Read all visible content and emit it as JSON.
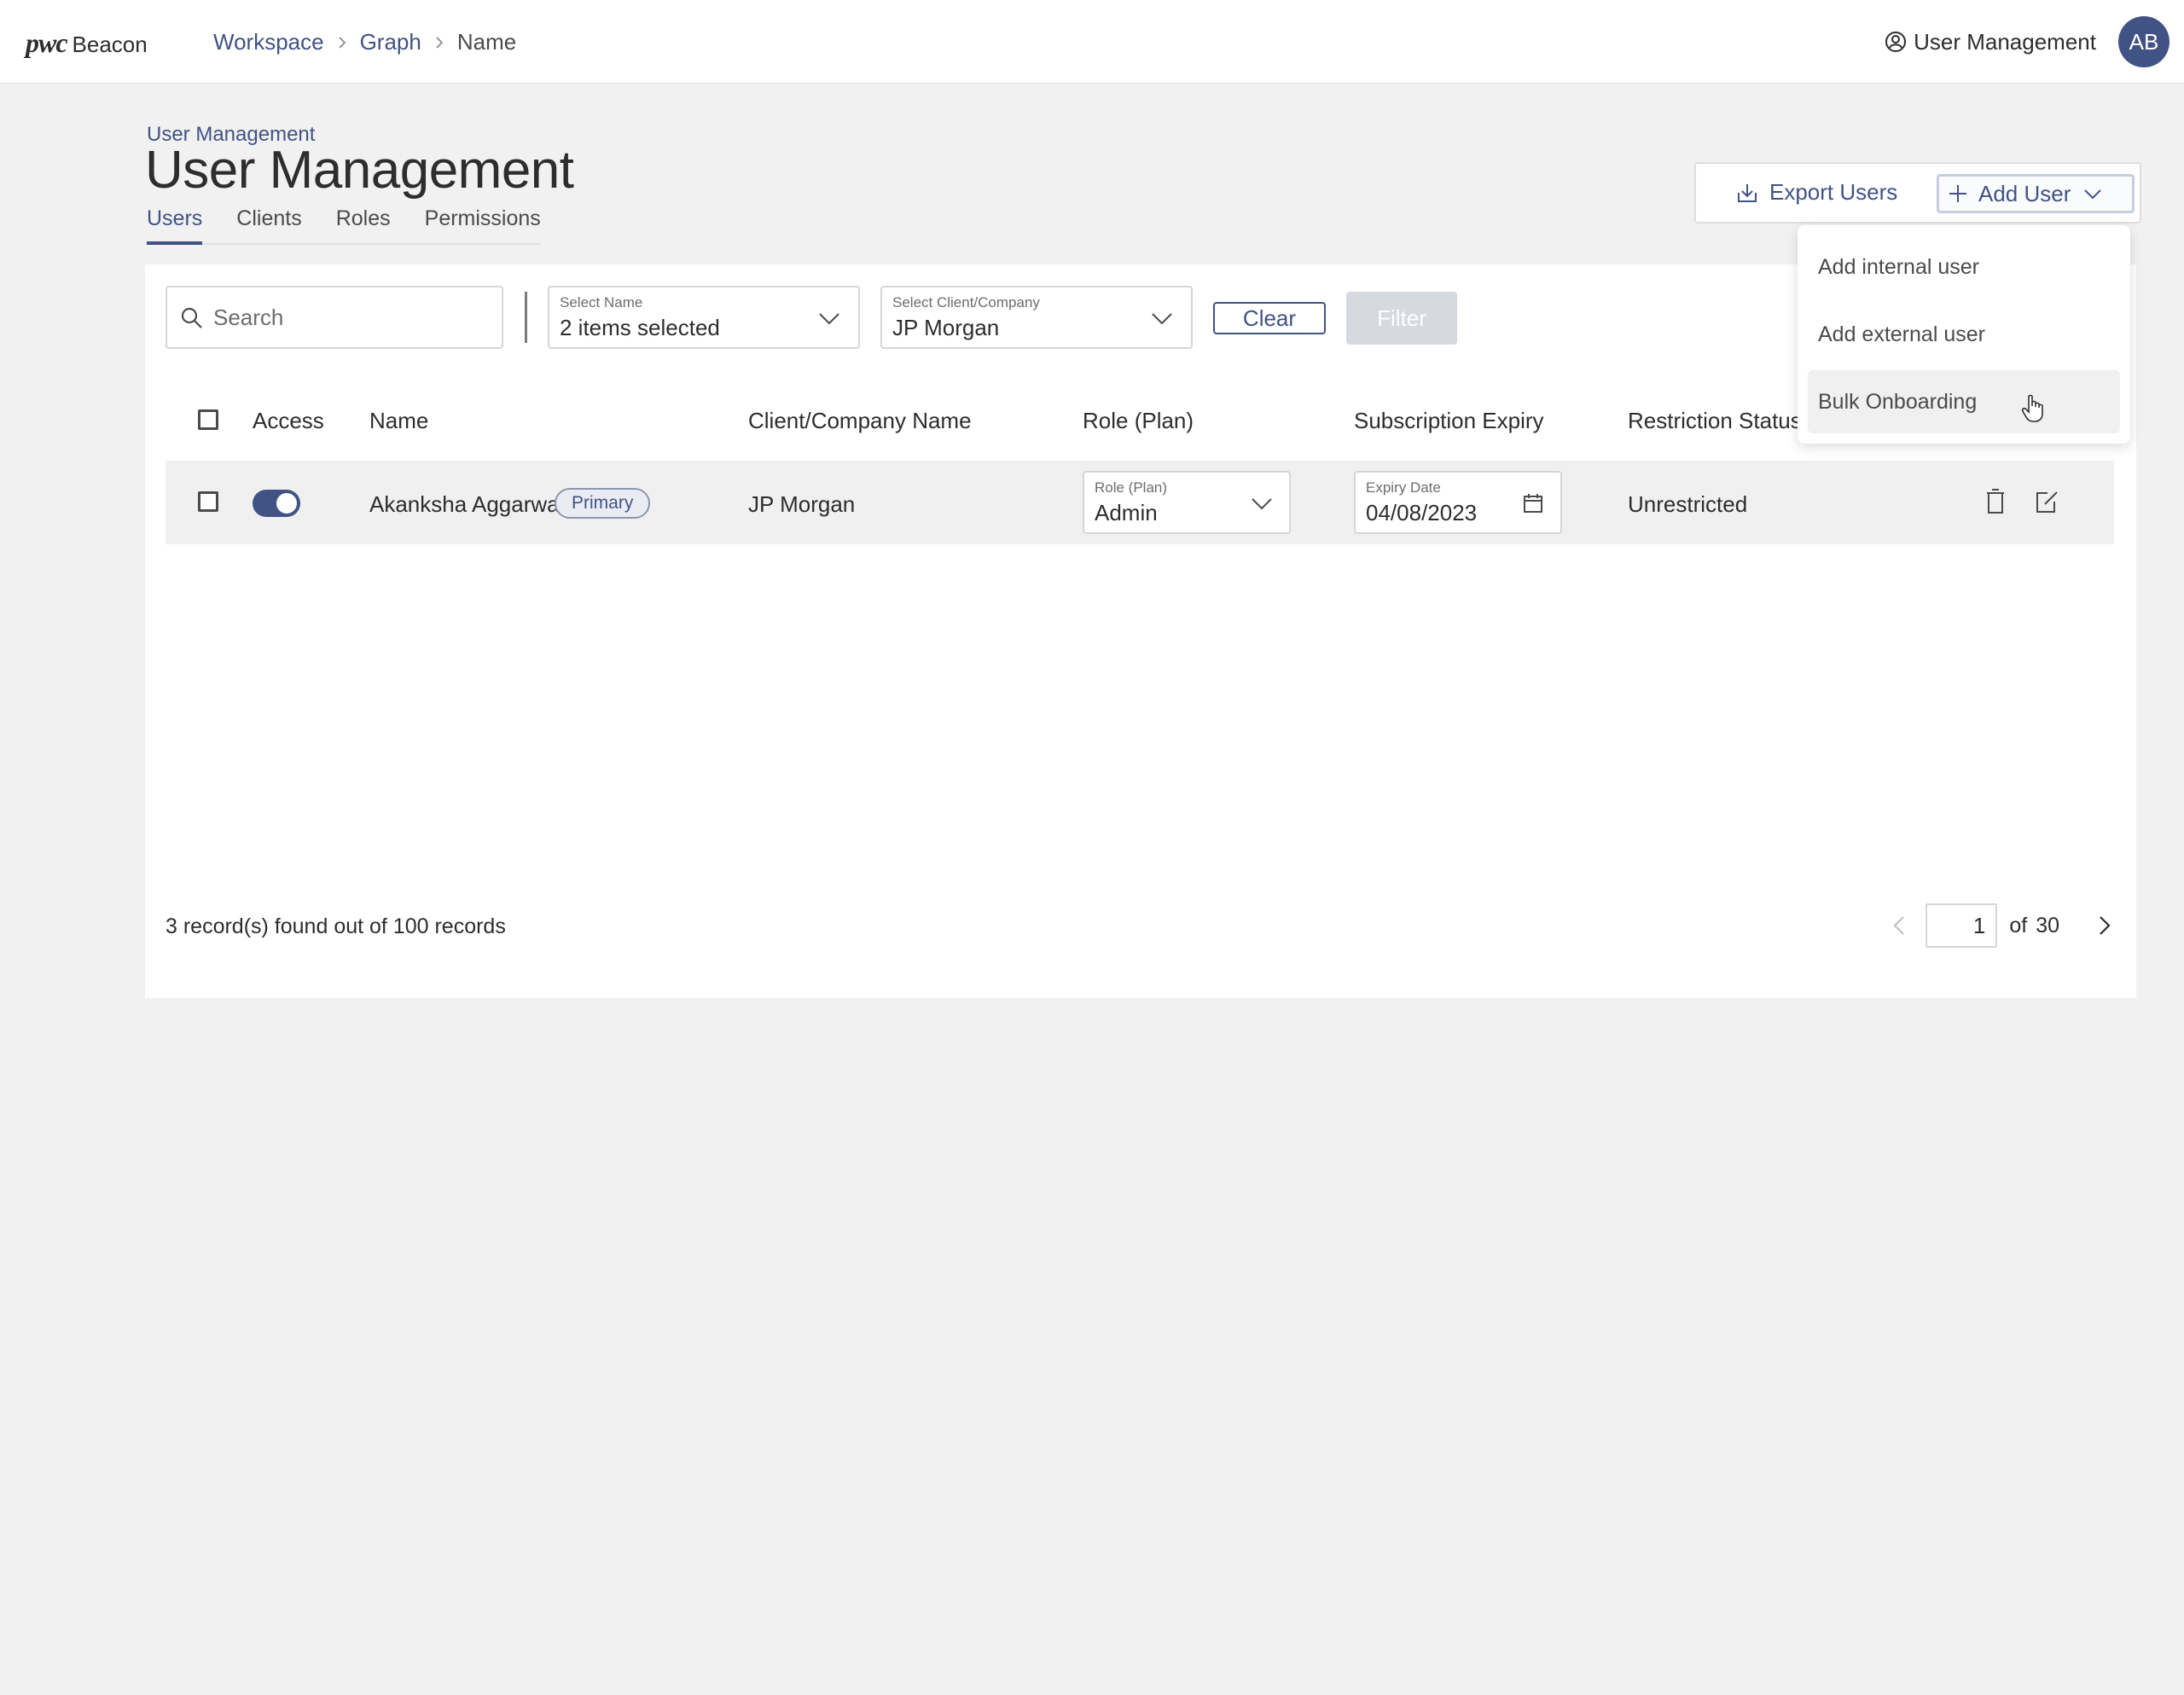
{
  "header": {
    "logo_mark": "pwc",
    "logo_text": "Beacon",
    "breadcrumb": [
      {
        "label": "Workspace"
      },
      {
        "label": "Graph"
      },
      {
        "label": "Name"
      }
    ],
    "user_management_label": "User Management",
    "user_management_icon": "user-circle-icon",
    "avatar_initials": "AB"
  },
  "page": {
    "breadcrumb": "User Management",
    "title": "User Management",
    "tabs": [
      {
        "label": "Users",
        "active": true
      },
      {
        "label": "Clients",
        "active": false
      },
      {
        "label": "Roles",
        "active": false
      },
      {
        "label": "Permissions",
        "active": false
      }
    ]
  },
  "actions": {
    "export_label": "Export Users",
    "export_icon": "download-icon",
    "add_user_label": "Add User",
    "add_icon": "plus-icon"
  },
  "add_user_menu": {
    "items": [
      {
        "label": "Add internal user"
      },
      {
        "label": "Add external user"
      },
      {
        "label": "Bulk Onboarding",
        "hovered": true
      }
    ]
  },
  "filters": {
    "search_placeholder": "Search",
    "name_select": {
      "label": "Select Name",
      "value": "2 items selected"
    },
    "client_select": {
      "label": "Select Client/Company",
      "value": "JP Morgan"
    },
    "clear_label": "Clear",
    "filter_label": "Filter"
  },
  "table": {
    "columns": [
      "Access",
      "Name",
      "Client/Company Name",
      "Role (Plan)",
      "Subscription Expiry",
      "Restriction Status"
    ],
    "rows": [
      {
        "access_enabled": true,
        "name": "Akanksha Aggarwal",
        "badge": "Primary",
        "client": "JP Morgan",
        "role_label": "Role (Plan)",
        "role_value": "Admin",
        "expiry_label": "Expiry Date",
        "expiry_value": "04/08/2023",
        "restriction": "Unrestricted"
      }
    ]
  },
  "footer": {
    "records_text": "3 record(s) found out of 100 records",
    "current_page": "1",
    "of_label": "of",
    "total_pages": "30"
  },
  "colors": {
    "accent": "#415385",
    "background": "#f1f1f1",
    "row_background": "#f0f0f0",
    "filter_disabled": "#d6d9e0"
  }
}
